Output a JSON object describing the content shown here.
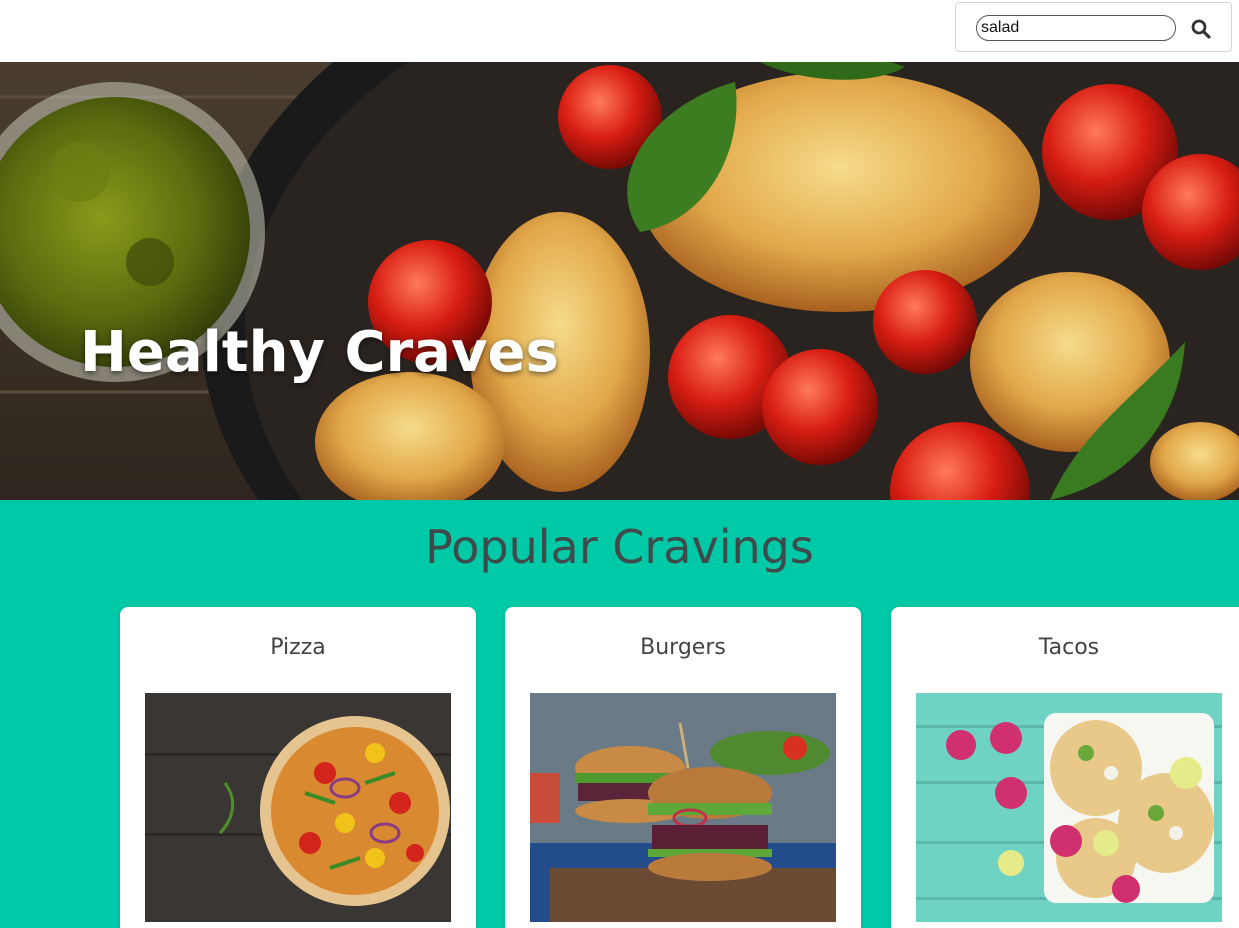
{
  "search": {
    "value": "salad",
    "icon": "search-icon"
  },
  "hero": {
    "title": "Healthy Craves"
  },
  "popular": {
    "title": "Popular Cravings",
    "cards": [
      {
        "title": "Pizza"
      },
      {
        "title": "Burgers"
      },
      {
        "title": "Tacos"
      }
    ]
  },
  "colors": {
    "accent": "#00c9a7",
    "heading": "#3f4a4a",
    "card_text": "#444444"
  }
}
